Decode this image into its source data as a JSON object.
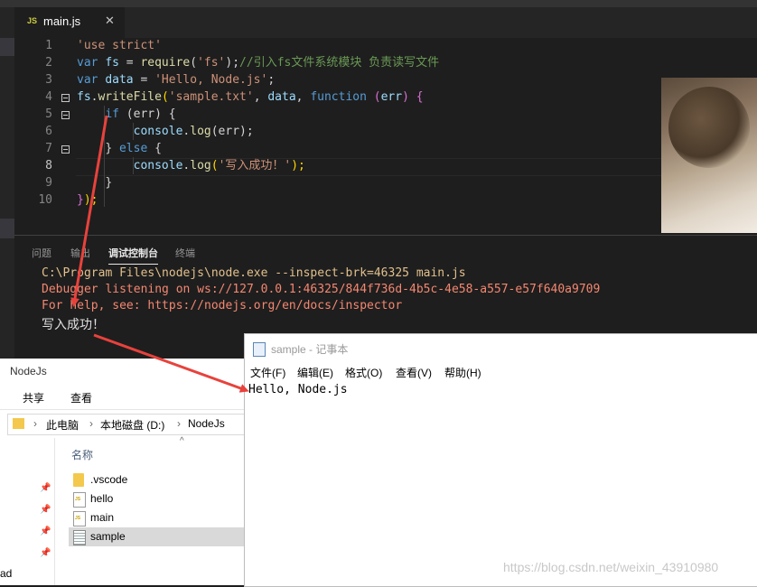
{
  "editor": {
    "tab_badge": "JS",
    "tab_name": "main.js",
    "tab_close": "✕",
    "line_numbers": [
      "1",
      "2",
      "3",
      "4",
      "5",
      "6",
      "7",
      "8",
      "9",
      "10"
    ],
    "code": {
      "l1": "'use strict'",
      "l2_kw": "var",
      "l2_var": "fs",
      "l2_eq": " = ",
      "l2_fn": "require",
      "l2_p1": "(",
      "l2_str": "'fs'",
      "l2_p2": ");",
      "l2_cmt": "//引入fs文件系统模块 负责读写文件",
      "l3_kw": "var",
      "l3_var": "data",
      "l3_eq": " = ",
      "l3_str": "'Hello, Node.js'",
      "l3_end": ";",
      "l4_obj": "fs",
      "l4_dot": ".",
      "l4_fn": "writeFile",
      "l4_p1": "(",
      "l4_str": "'sample.txt'",
      "l4_c1": ", ",
      "l4_var": "data",
      "l4_c2": ", ",
      "l4_kw": "function",
      "l4_sp": " ",
      "l4_p2": "(",
      "l4_arg": "err",
      "l4_p3": ")",
      "l4_br": " {",
      "l5_kw": "if",
      "l5_rest": " (err) {",
      "l6_obj": "console",
      "l6_dot": ".",
      "l6_fn": "log",
      "l6_rest": "(err);",
      "l7_br": "}",
      "l7_kw": " else",
      "l7_rest": " {",
      "l8_obj": "console",
      "l8_dot": ".",
      "l8_fn": "log",
      "l8_p1": "(",
      "l8_str": "'写入成功！'",
      "l8_p2": ");",
      "l9": "}",
      "l10_br": "}",
      "l10_rest": ");"
    }
  },
  "panel": {
    "tabs": [
      "问题",
      "输出",
      "调试控制台",
      "终端"
    ],
    "lines": [
      "C:\\Program Files\\nodejs\\node.exe --inspect-brk=46325 main.js",
      "Debugger listening on ws://127.0.0.1:46325/844f736d-4b5c-4e58-a557-e57f640a9709",
      "For help, see: https://nodejs.org/en/docs/inspector",
      "写入成功！"
    ]
  },
  "explorer": {
    "title": "NodeJs",
    "ribbon": [
      "共享",
      "查看"
    ],
    "breadcrumb": [
      "此电脑",
      "本地磁盘 (D:)",
      "NodeJs"
    ],
    "column_header": "名称",
    "files": [
      ".vscode",
      "hello",
      "main",
      "sample"
    ],
    "left_label": "ad"
  },
  "notepad": {
    "title": "sample - 记事本",
    "menu": [
      "文件(F)",
      "编辑(E)",
      "格式(O)",
      "查看(V)",
      "帮助(H)"
    ],
    "content": "Hello, Node.js"
  },
  "watermark": "https://blog.csdn.net/weixin_43910980",
  "colors": {
    "editor_bg": "#1e1e1e",
    "arrow": "#e8423c"
  }
}
